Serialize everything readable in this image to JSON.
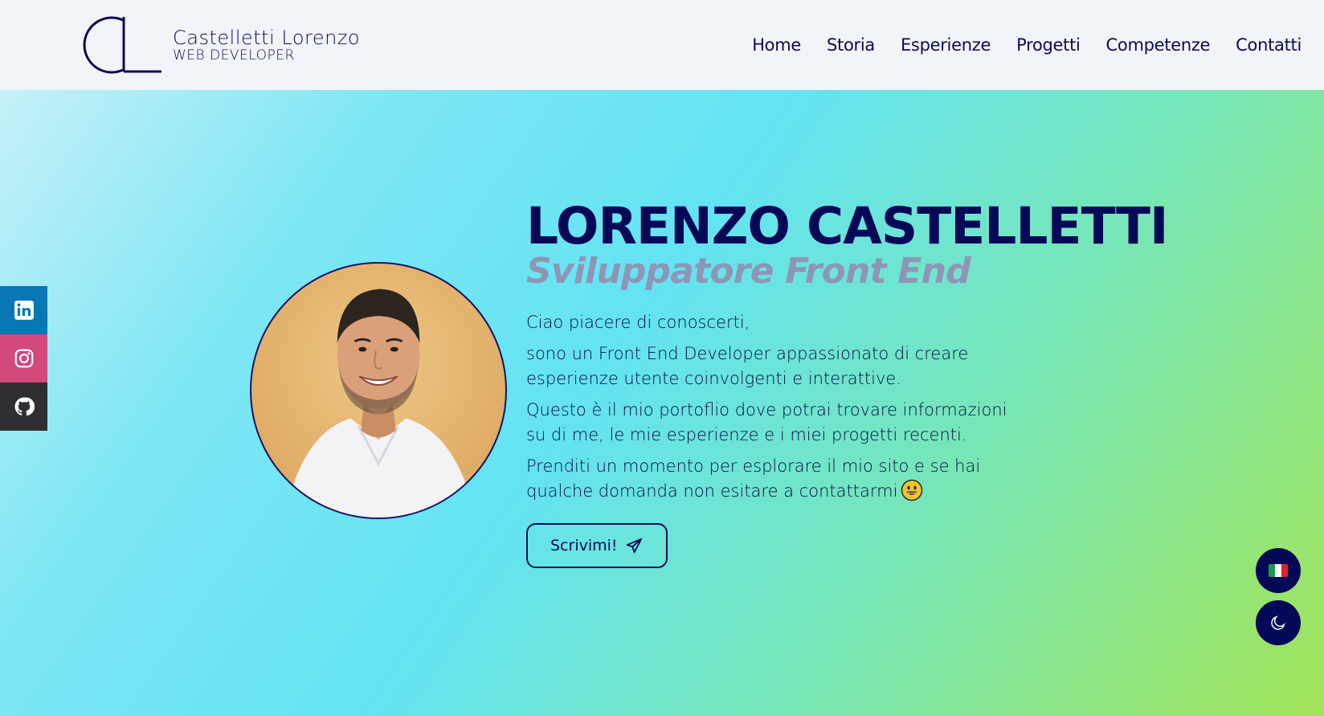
{
  "brand": {
    "name": "Castelletti Lorenzo",
    "subtitle": "WEB DEVELOPER",
    "logo_icon": "cl-monogram-icon"
  },
  "nav": {
    "items": [
      {
        "label": "Home"
      },
      {
        "label": "Storia"
      },
      {
        "label": "Esperienze"
      },
      {
        "label": "Progetti"
      },
      {
        "label": "Competenze"
      },
      {
        "label": "Contatti"
      }
    ]
  },
  "social": [
    {
      "icon": "linkedin-icon",
      "color": "#0a77b5"
    },
    {
      "icon": "instagram-icon",
      "color": "#d1497d"
    },
    {
      "icon": "github-icon",
      "color": "#2d2f33"
    }
  ],
  "hero": {
    "name": "LORENZO CASTELLETTI",
    "role": "Sviluppatore Front End",
    "paragraphs": [
      "Ciao piacere di conoscerti,",
      "sono un Front End Developer appassionato di creare esperienze utente coinvolgenti e interattive.",
      "Questo è il mio portoflio dove potrai trovare informazioni su di me, le mie esperienze e i miei progetti recenti.",
      "Prenditi un momento per esplorare il mio sito e se hai qualche domanda non esitare a contattarmi"
    ],
    "cta_label": "Scrivimi!",
    "cta_icon": "paper-plane-icon",
    "emoji_icon": "smiling-face-icon"
  },
  "floating": {
    "language_icon": "italian-flag-icon",
    "theme_icon": "moon-icon"
  },
  "colors": {
    "primary": "#050857",
    "role_text": "#8f95b5",
    "nav_bg": "#f1f4f9"
  }
}
